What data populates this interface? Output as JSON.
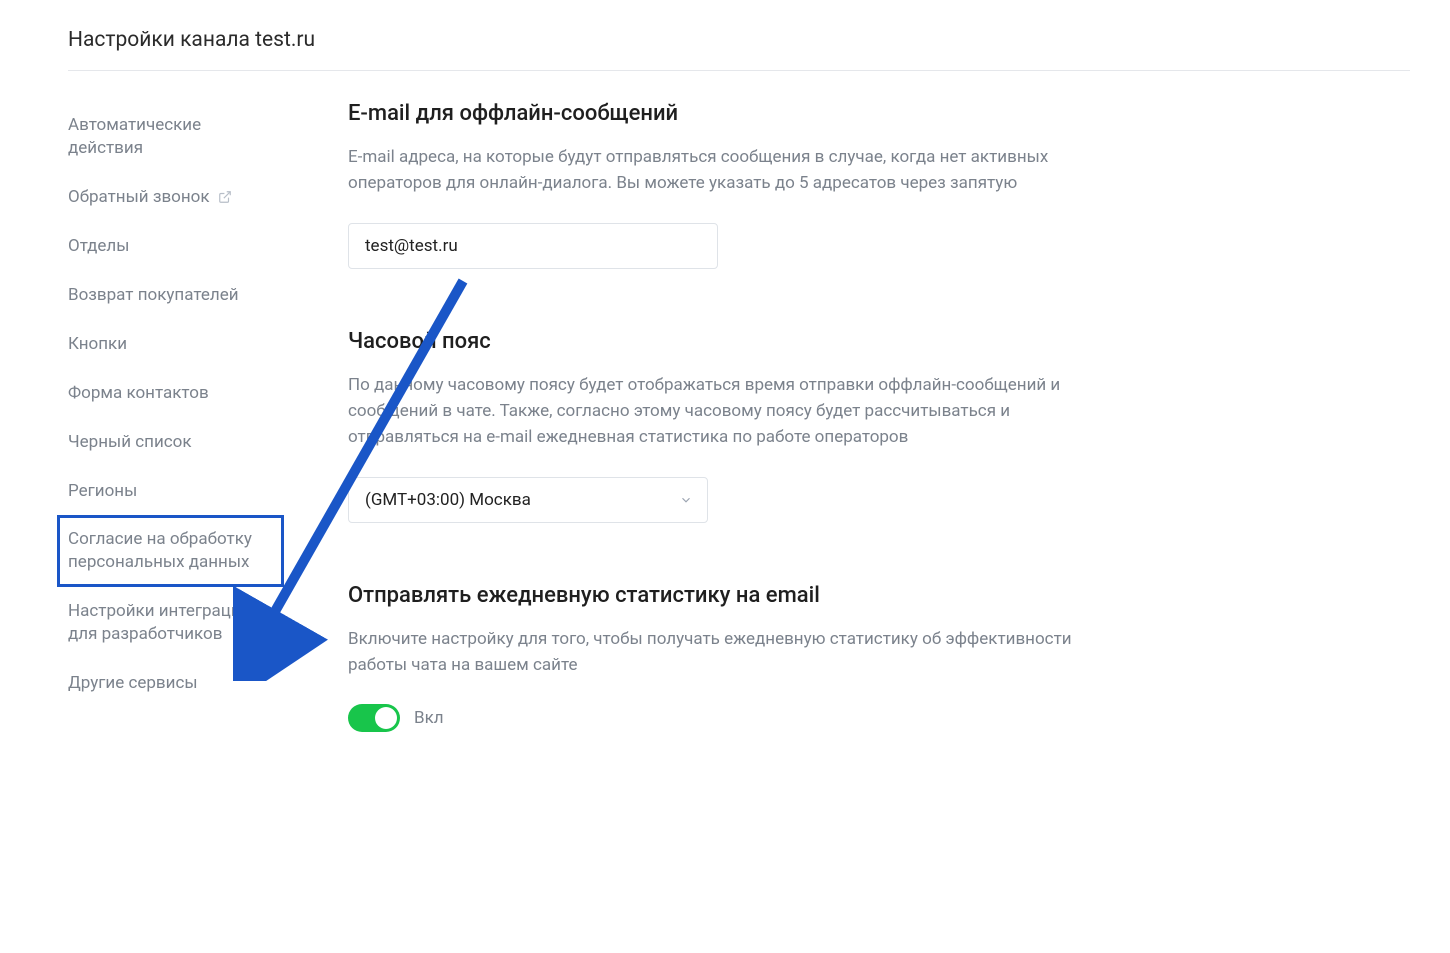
{
  "header": {
    "title": "Настройки канала test.ru"
  },
  "sidebar": {
    "items": [
      {
        "label": "Автоматические действия",
        "external": false,
        "highlight": false
      },
      {
        "label": "Обратный звонок",
        "external": true,
        "highlight": false
      },
      {
        "label": "Отделы",
        "external": false,
        "highlight": false
      },
      {
        "label": "Возврат покупателей",
        "external": false,
        "highlight": false
      },
      {
        "label": "Кнопки",
        "external": false,
        "highlight": false
      },
      {
        "label": "Форма контактов",
        "external": false,
        "highlight": false
      },
      {
        "label": "Черный список",
        "external": false,
        "highlight": false
      },
      {
        "label": "Регионы",
        "external": false,
        "highlight": false
      },
      {
        "label": "Согласие на обработку персональных данных",
        "external": false,
        "highlight": true
      },
      {
        "label": "Настройки интеграции для разработчиков",
        "external": false,
        "highlight": false
      },
      {
        "label": "Другие сервисы",
        "external": false,
        "highlight": false
      }
    ]
  },
  "sections": {
    "email": {
      "title": "E-mail для оффлайн-сообщений",
      "desc": "E-mail адреса, на которые будут отправляться сообщения в случае, когда нет активных операторов для онлайн-диалога. Вы можете указать до 5 адресатов через запятую",
      "value": "test@test.ru"
    },
    "timezone": {
      "title": "Часовой пояс",
      "desc": "По данному часовому поясу будет отображаться время отправки оффлайн-сообщений и сообщений в чате. Также, согласно этому часовому поясу будет рассчитываться и отправляться на e-mail ежедневная статистика по работе операторов",
      "value": "(GMT+03:00) Москва"
    },
    "stats": {
      "title": "Отправлять ежедневную статистику на email",
      "desc": "Включите настройку для того, чтобы получать ежедневную статистику об эффективности работы чата на вашем сайте",
      "toggle_label": "Вкл",
      "toggle_on": true
    }
  },
  "annotation": {
    "arrow_color": "#1a56c7"
  }
}
